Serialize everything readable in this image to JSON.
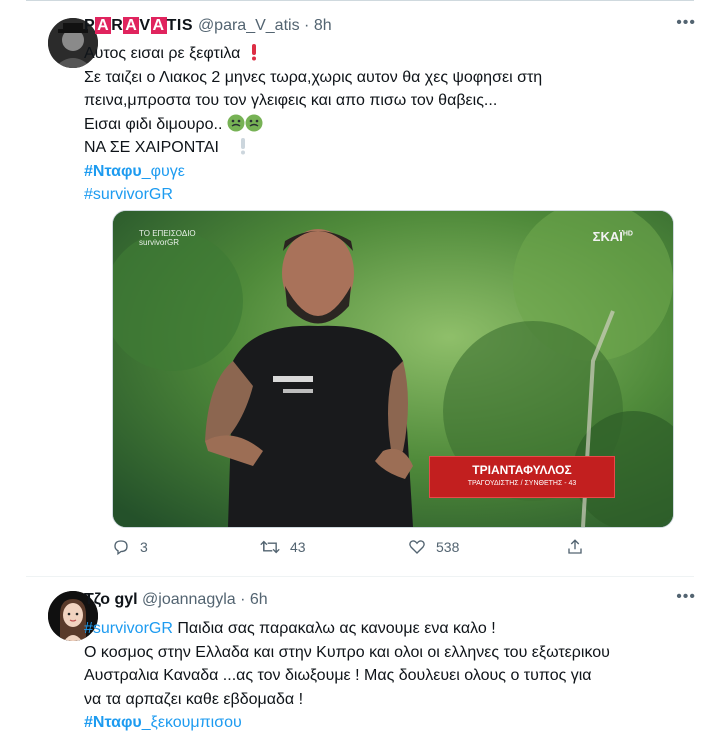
{
  "tweets": [
    {
      "author": {
        "name_letters": [
          "P",
          "A",
          "R",
          "A",
          "V",
          "A",
          "TIS"
        ],
        "handle": "@para_V_atis",
        "time": "8h"
      },
      "more_label": "•••",
      "lines": [
        "Αυτος εισαι ρε ξεφτιλα",
        "Σε ταιζει ο Λιακος 2 μηνες τωρα,χωρις αυτον θα χες ψοφησει στη",
        "πεινα,μπροστα του τον γλειφεις και απο πισω τον θαβεις...",
        "Εισαι φιδι διμουρο..",
        "ΝΑ ΣΕ ΧΑΙΡΟΝΤΑΙ"
      ],
      "hashtags": [
        {
          "bold": "#Νταφυ",
          "rest": "_φυγε"
        },
        {
          "bold": "",
          "rest": "#survivorGR"
        }
      ],
      "media": {
        "logo_line1": "ΤΟ ΕΠΕΙΣΟΔΙΟ",
        "logo_line2": "survivorGR",
        "channel": "ΣΚΑΪ",
        "channel_sup": "HD",
        "caption_name": "ΤΡΙΑΝΤΑΦΥΛΛΟΣ",
        "caption_sub": "ΤΡΑΓΟΥΔΙΣΤΗΣ / ΣΥΝΘΕΤΗΣ - 43"
      },
      "actions": {
        "replies": "3",
        "retweets": "43",
        "likes": "538"
      }
    },
    {
      "author": {
        "name": "Τζο gyl",
        "handle": "@joannagyla",
        "time": "6h"
      },
      "more_label": "•••",
      "lines": [
        "Παιδια σας παρακαλω ας κανουμε ενα καλο !",
        "Ο κοσμος στην Ελλαδα και στην Κυπρο και ολοι οι ελληνες του εξωτερικου",
        "Αυστραλια Καναδα ...ας τον διωξουμε ! Μας δουλευει ολους ο τυπος για",
        "να τα αρπαζει καθε εβδομαδα !"
      ],
      "first_hashtag": "#survivorGR",
      "hashtag": {
        "bold": "#Νταφυ",
        "rest": "_ξεκουμπισου"
      }
    }
  ],
  "colors": {
    "link": "#1d9bf0",
    "muted": "#536471",
    "name_badge": "#e0245e"
  },
  "icons": [
    "reply-icon",
    "retweet-icon",
    "like-icon",
    "share-icon",
    "more-icon",
    "exclamation-emoji",
    "nauseated-face-emoji"
  ]
}
